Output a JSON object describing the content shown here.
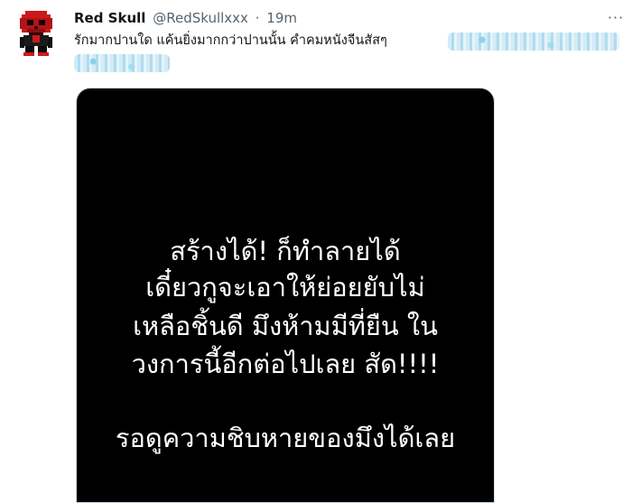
{
  "tweet": {
    "author_name": "Red Skull",
    "handle": "@RedSkullxxx",
    "separator": "·",
    "time": "19m",
    "text": "รักมากปานใด แค้นยิ่งมากกว่าปานนั้น คำคมหนังจีนสัสๆ",
    "more_label": "···"
  },
  "media": {
    "lines": [
      "สร้างได้! ก็ทำลายได้",
      "เดี๋ยวกูจะเอาให้ย่อยยับไม่",
      "เหลือชิ้นดี มึงห้ามมีที่ยืน ใน",
      "วงการนี้อีกต่อไปเลย สัด!!!!",
      "",
      "รอดูความชิบหายของมึงได้เลย"
    ]
  },
  "colors": {
    "avatar_red": "#cc1a1a",
    "avatar_dark": "#3a0000",
    "media_bg": "#000000",
    "muted_text": "#536471",
    "blur_blue": "#a8d8ee"
  }
}
